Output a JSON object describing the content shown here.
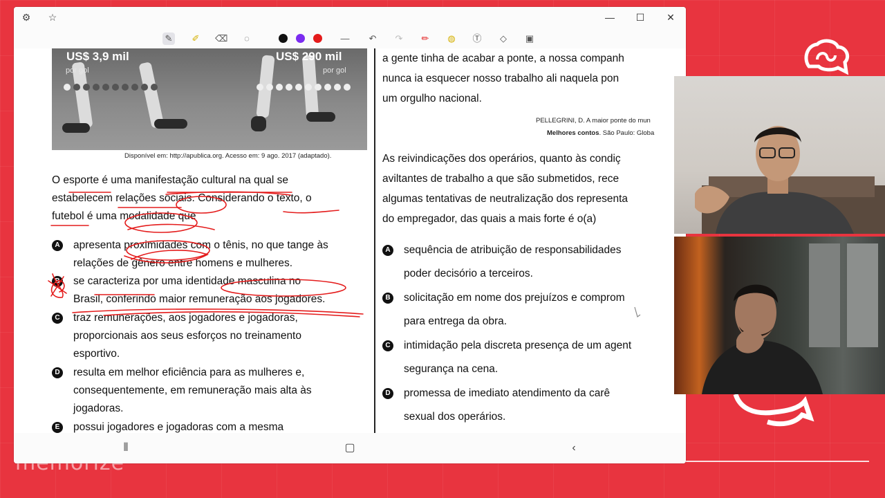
{
  "toolbar": {
    "colors": [
      "#111111",
      "#7b2cf0",
      "#e41b1b"
    ]
  },
  "photo": {
    "left_price": "US$ 3,9 mil",
    "left_unit": "por gol",
    "right_price": "US$ 290 mil",
    "right_unit": "por gol",
    "caption": "Disponível em: http://apublica.org. Acesso em: 9 ago. 2017 (adaptado)."
  },
  "left": {
    "paragraph": [
      "O esporte é uma manifestação cultural na qual se",
      "estabelecem relações sociais. Considerando o texto, o",
      "futebol é uma modalidade que"
    ],
    "options": [
      {
        "letter": "A",
        "lines": [
          "apresenta proximidades com o tênis, no que tange às",
          "relações de gênero entre homens e mulheres."
        ]
      },
      {
        "letter": "B",
        "lines": [
          "se caracteriza por uma identidade masculina no",
          "Brasil, conferindo maior remuneração aos jogadores."
        ]
      },
      {
        "letter": "C",
        "lines": [
          "traz remunerações, aos jogadores e jogadoras,",
          "proporcionais aos seus esforços no treinamento",
          "esportivo."
        ]
      },
      {
        "letter": "D",
        "lines": [
          "resulta em melhor eficiência para as mulheres e,",
          "consequentemente, em remuneração mais alta às",
          "jogadoras."
        ]
      },
      {
        "letter": "E",
        "lines": [
          "possui jogadores e jogadoras com a mesma"
        ]
      }
    ]
  },
  "right": {
    "top_lines": [
      "a gente tinha de acabar a ponte, a nossa companh",
      "nunca ia esquecer nosso trabalho ali naquela pon",
      "um orgulho nacional."
    ],
    "ref_line1": "PELLEGRINI, D. A maior ponte do mun",
    "ref_line2_bold": "Melhores contos",
    "ref_line2_rest": ". São Paulo: Globa",
    "question": [
      "As reivindicações dos operários, quanto às condiç",
      "aviltantes de trabalho a que são submetidos, rece",
      "algumas tentativas de neutralização dos representa",
      "do empregador, das quais a mais forte é o(a)"
    ],
    "options": [
      {
        "letter": "A",
        "lines": [
          "sequência de atribuição de responsabilidades",
          "poder decisório a terceiros."
        ]
      },
      {
        "letter": "B",
        "lines": [
          "solicitação em nome dos prejuízos e comprom",
          "para entrega da obra."
        ]
      },
      {
        "letter": "C",
        "lines": [
          "intimidação pela discreta presença de um agent",
          "segurança na cena."
        ]
      },
      {
        "letter": "D",
        "lines": [
          "promessa de imediato atendimento da carê",
          "sexual dos operários."
        ]
      }
    ]
  },
  "brand": {
    "bottom_text": "memorize"
  }
}
